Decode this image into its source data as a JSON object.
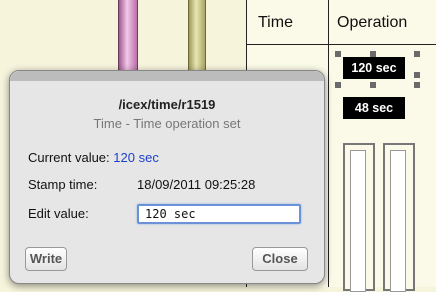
{
  "grid": {
    "headers": [
      "Time",
      "Operation"
    ],
    "values": [
      "120 sec",
      "48 sec"
    ]
  },
  "popup": {
    "title": "/icex/time/r1519",
    "subtitle": "Time - Time operation set",
    "current_value_label": "Current value:",
    "current_value": "120 sec",
    "stamp_time_label": "Stamp time:",
    "stamp_time": "18/09/2011 09:25:28",
    "edit_value_label": "Edit value:",
    "edit_value": "120 sec",
    "write_label": "Write",
    "close_label": "Close"
  },
  "colors": {
    "accent_value": "#1a3fd0",
    "input_focus": "#6a93d7"
  }
}
